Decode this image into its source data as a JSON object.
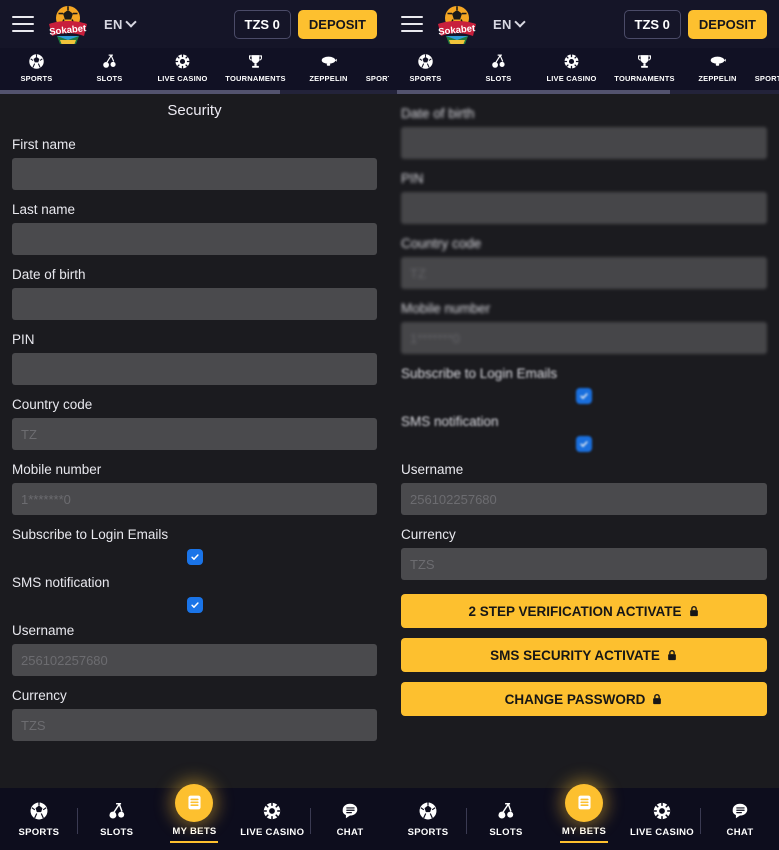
{
  "colors": {
    "accent": "#fdc02f",
    "topbar_bg": "#151528",
    "catnav_bg": "#111124",
    "page_bg": "#1b1b1f",
    "input_bg": "#4a4a4d",
    "checkbox_blue": "#1a74e8",
    "bottombar_bg": "#0d0d1d"
  },
  "topbar": {
    "menu_icon": "hamburger-menu-icon",
    "logo_text": "Sokabet",
    "language": "EN",
    "balance": "TZS 0",
    "deposit_label": "DEPOSIT"
  },
  "categories": [
    {
      "label": "SPORTS",
      "icon": "soccer-ball-icon"
    },
    {
      "label": "SLOTS",
      "icon": "cherries-icon"
    },
    {
      "label": "LIVE CASINO",
      "icon": "roulette-wheel-icon"
    },
    {
      "label": "TOURNAMENTS",
      "icon": "trophy-icon"
    },
    {
      "label": "ZEPPELIN",
      "icon": "zeppelin-icon"
    },
    {
      "label": "SPORTS JACKPOT",
      "icon": "money-bag-icon"
    }
  ],
  "page": {
    "title": "Security"
  },
  "form": {
    "first_name": {
      "label": "First name",
      "value": ""
    },
    "last_name": {
      "label": "Last name",
      "value": ""
    },
    "date_of_birth": {
      "label": "Date of birth",
      "value": ""
    },
    "pin": {
      "label": "PIN",
      "value": ""
    },
    "country_code": {
      "label": "Country code",
      "value": "TZ"
    },
    "mobile_number": {
      "label": "Mobile number",
      "value": "1*******0"
    },
    "subscribe_emails": {
      "label": "Subscribe to Login Emails",
      "checked": true
    },
    "sms_notification": {
      "label": "SMS notification",
      "checked": true
    },
    "username": {
      "label": "Username",
      "value": "256102257680"
    },
    "currency": {
      "label": "Currency",
      "value": "TZS"
    }
  },
  "actions": {
    "two_step": "2 STEP VERIFICATION ACTIVATE",
    "sms_security": "SMS SECURITY ACTIVATE",
    "change_password": "CHANGE PASSWORD",
    "lock_glyph": "🔒"
  },
  "bottomnav": [
    {
      "label": "SPORTS",
      "icon": "soccer-ball-icon",
      "active": false
    },
    {
      "label": "SLOTS",
      "icon": "cherries-icon",
      "active": false
    },
    {
      "label": "MY BETS",
      "icon": "bet-slip-icon",
      "active": true
    },
    {
      "label": "LIVE CASINO",
      "icon": "roulette-wheel-icon",
      "active": false
    },
    {
      "label": "CHAT",
      "icon": "chat-bubble-icon",
      "active": false
    }
  ]
}
